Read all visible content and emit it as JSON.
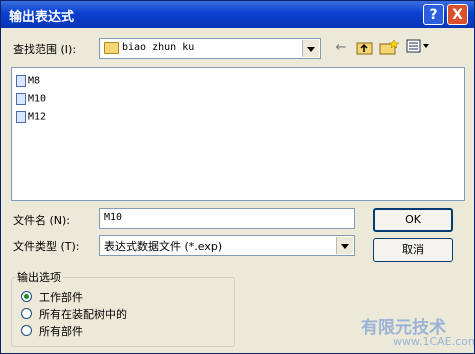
{
  "dialog": {
    "title": "输出表达式"
  },
  "title_buttons": {
    "help": "?",
    "close": "X"
  },
  "look_in": {
    "label": "查找范围 (I):",
    "value": "biao zhun ku"
  },
  "toolbar": {
    "back_icon": "back-arrow-icon",
    "up_icon": "up-folder-icon",
    "new_folder_icon": "new-folder-icon",
    "view_icon": "view-menu-icon"
  },
  "files": [
    {
      "name": "M8"
    },
    {
      "name": "M10"
    },
    {
      "name": "M12"
    }
  ],
  "filename": {
    "label": "文件名 (N):",
    "value": "M10"
  },
  "filetype": {
    "label": "文件类型 (T):",
    "value": "表达式数据文件 (*.exp)"
  },
  "buttons": {
    "ok": "OK",
    "cancel": "取消"
  },
  "output_options": {
    "title": "输出选项",
    "options": [
      {
        "label": "工作部件",
        "selected": true
      },
      {
        "label": "所有在装配树中的",
        "selected": false
      },
      {
        "label": "所有部件",
        "selected": false
      }
    ]
  },
  "watermark": {
    "text": "有限元技术",
    "site": "www.1CAE.com"
  }
}
